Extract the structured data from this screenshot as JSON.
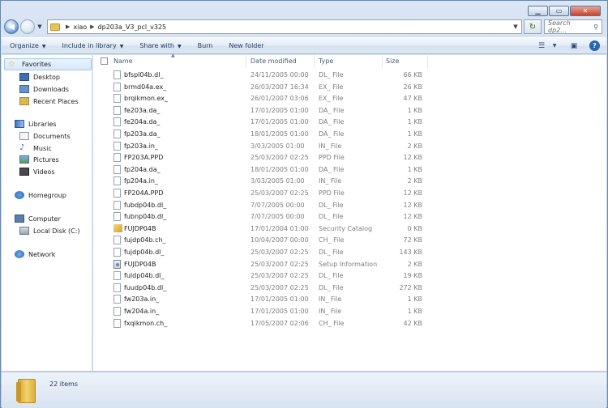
{
  "address": {
    "crumbs": [
      "xiao",
      "dp203a_V3_pcl_v325"
    ],
    "search_placeholder": "Search dp2..."
  },
  "toolbar": {
    "organize": "Organize",
    "include_in_library": "Include in library",
    "share_with": "Share with",
    "burn": "Burn",
    "new_folder": "New folder"
  },
  "nav": {
    "favorites": "Favorites",
    "desktop": "Desktop",
    "downloads": "Downloads",
    "recent_places": "Recent Places",
    "libraries": "Libraries",
    "documents": "Documents",
    "music": "Music",
    "pictures": "Pictures",
    "videos": "Videos",
    "homegroup": "Homegroup",
    "computer": "Computer",
    "local_disk": "Local Disk (C:)",
    "network": "Network"
  },
  "columns": {
    "name": "Name",
    "date_modified": "Date modified",
    "type": "Type",
    "size": "Size"
  },
  "files": [
    {
      "name": "bfspl04b.dl_",
      "date": "24/11/2005 00:00",
      "type": "DL_ File",
      "size": "66 KB",
      "icon": "file-icon"
    },
    {
      "name": "brmd04a.ex_",
      "date": "26/03/2007 16:34",
      "type": "EX_ File",
      "size": "26 KB",
      "icon": "file-icon"
    },
    {
      "name": "brqikmon.ex_",
      "date": "26/01/2007 03:06",
      "type": "EX_ File",
      "size": "47 KB",
      "icon": "file-icon"
    },
    {
      "name": "fe203a.da_",
      "date": "17/01/2005 01:00",
      "type": "DA_ File",
      "size": "1 KB",
      "icon": "file-icon"
    },
    {
      "name": "fe204a.da_",
      "date": "17/01/2005 01:00",
      "type": "DA_ File",
      "size": "1 KB",
      "icon": "file-icon"
    },
    {
      "name": "fp203a.da_",
      "date": "18/01/2005 01:00",
      "type": "DA_ File",
      "size": "1 KB",
      "icon": "file-icon"
    },
    {
      "name": "fp203a.in_",
      "date": "3/03/2005 01:00",
      "type": "IN_ File",
      "size": "2 KB",
      "icon": "file-icon"
    },
    {
      "name": "FP203A.PPD",
      "date": "25/03/2007 02:25",
      "type": "PPD File",
      "size": "12 KB",
      "icon": "file-icon"
    },
    {
      "name": "fp204a.da_",
      "date": "18/01/2005 01:00",
      "type": "DA_ File",
      "size": "1 KB",
      "icon": "file-icon"
    },
    {
      "name": "fp204a.in_",
      "date": "3/03/2005 01:00",
      "type": "IN_ File",
      "size": "2 KB",
      "icon": "file-icon"
    },
    {
      "name": "FP204A.PPD",
      "date": "25/03/2007 02:25",
      "type": "PPD File",
      "size": "12 KB",
      "icon": "file-icon"
    },
    {
      "name": "fubdp04b.dl_",
      "date": "7/07/2005 00:00",
      "type": "DL_ File",
      "size": "12 KB",
      "icon": "file-icon"
    },
    {
      "name": "fubnp04b.dl_",
      "date": "7/07/2005 00:00",
      "type": "DL_ File",
      "size": "12 KB",
      "icon": "file-icon"
    },
    {
      "name": "FUJDP04B",
      "date": "17/01/2004 01:00",
      "type": "Security Catalog",
      "size": "0 KB",
      "icon": "security-catalog-icon"
    },
    {
      "name": "fujdp04b.ch_",
      "date": "10/04/2007 00:00",
      "type": "CH_ File",
      "size": "72 KB",
      "icon": "file-icon"
    },
    {
      "name": "fujdp04b.dl_",
      "date": "25/03/2007 02:25",
      "type": "DL_ File",
      "size": "143 KB",
      "icon": "file-icon"
    },
    {
      "name": "FUJDP04B",
      "date": "25/03/2007 02:25",
      "type": "Setup Information",
      "size": "2 KB",
      "icon": "setup-information-icon"
    },
    {
      "name": "fuldp04b.dl_",
      "date": "25/03/2007 02:25",
      "type": "DL_ File",
      "size": "19 KB",
      "icon": "file-icon"
    },
    {
      "name": "fuudp04b.dl_",
      "date": "25/03/2007 02:25",
      "type": "DL_ File",
      "size": "272 KB",
      "icon": "file-icon"
    },
    {
      "name": "fw203a.in_",
      "date": "17/01/2005 01:00",
      "type": "IN_ File",
      "size": "1 KB",
      "icon": "file-icon"
    },
    {
      "name": "fw204a.in_",
      "date": "17/01/2005 01:00",
      "type": "IN_ File",
      "size": "1 KB",
      "icon": "file-icon"
    },
    {
      "name": "fxqikmon.ch_",
      "date": "17/05/2007 02:06",
      "type": "CH_ File",
      "size": "42 KB",
      "icon": "file-icon"
    }
  ],
  "status": {
    "item_count": "22 items"
  }
}
